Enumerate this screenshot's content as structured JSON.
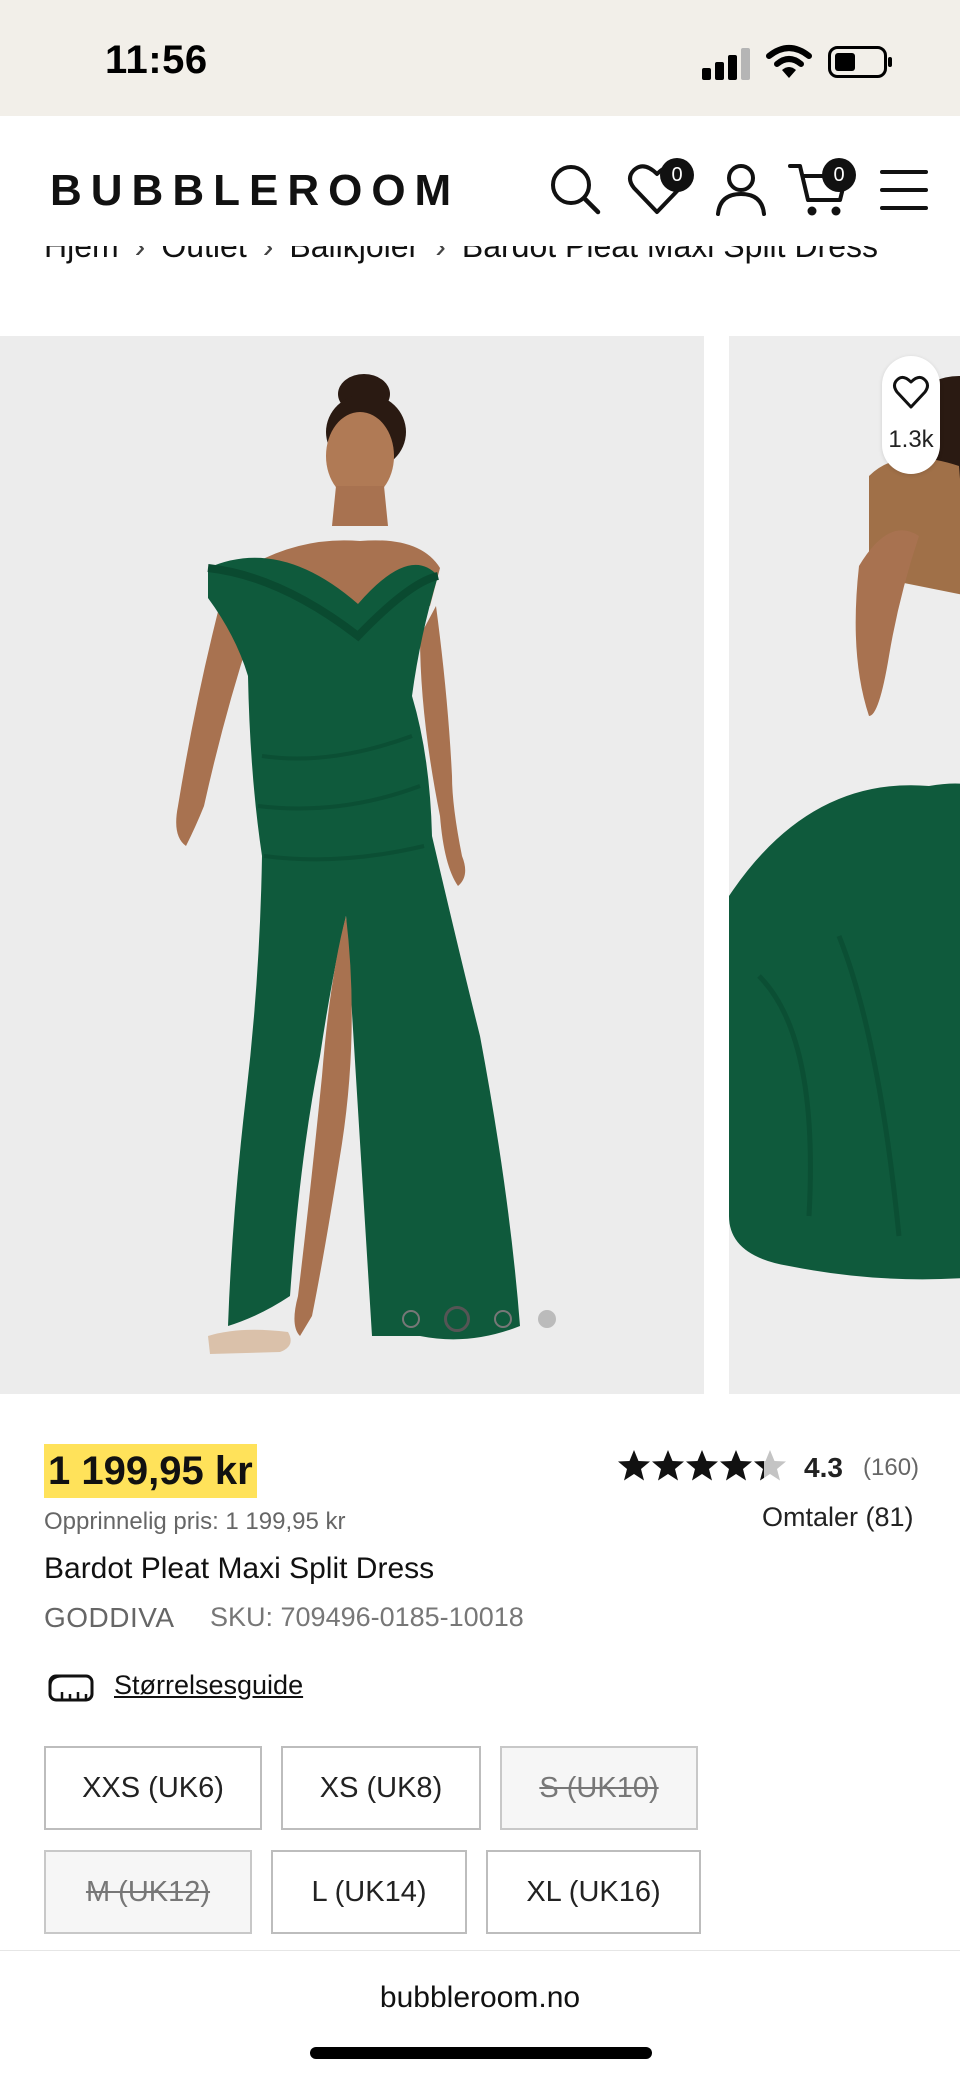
{
  "status_bar": {
    "time": "11:56"
  },
  "header": {
    "logo": "BUBBLEROOM",
    "wishlist_count": "0",
    "cart_count": "0",
    "icons": [
      "search-icon",
      "heart-icon",
      "account-icon",
      "cart-icon",
      "menu-icon"
    ]
  },
  "breadcrumb": [
    "Hjem",
    "Outlet",
    "Ballkjoler",
    "Bardot Pleat Maxi Split Dress"
  ],
  "gallery": {
    "wish_count": "1.3k",
    "dots_total": 4,
    "active_dot": 2,
    "dress_color": "#0f5a3c"
  },
  "product": {
    "price": "1 199,95 kr",
    "original_price": "Opprinnelig pris: 1 199,95 kr",
    "name": "Bardot Pleat Maxi Split Dress",
    "brand": "GODDIVA",
    "sku": "SKU: 709496-0185-10018",
    "rating_value": "4.3",
    "rating_count": "(160)",
    "rating_stars": 4.3,
    "reviews_link": "Omtaler (81)",
    "size_guide": "Størrelsesguide"
  },
  "sizes": [
    {
      "label": "XXS (UK6)",
      "available": true
    },
    {
      "label": "XS (UK8)",
      "available": true
    },
    {
      "label": "S (UK10)",
      "available": false
    },
    {
      "label": "M (UK12)",
      "available": false
    },
    {
      "label": "L (UK14)",
      "available": true
    },
    {
      "label": "XL (UK16)",
      "available": true
    }
  ],
  "browser": {
    "url": "bubbleroom.no"
  },
  "colors": {
    "price_highlight": "#ffe25a",
    "background_status": "#f2efe9"
  }
}
